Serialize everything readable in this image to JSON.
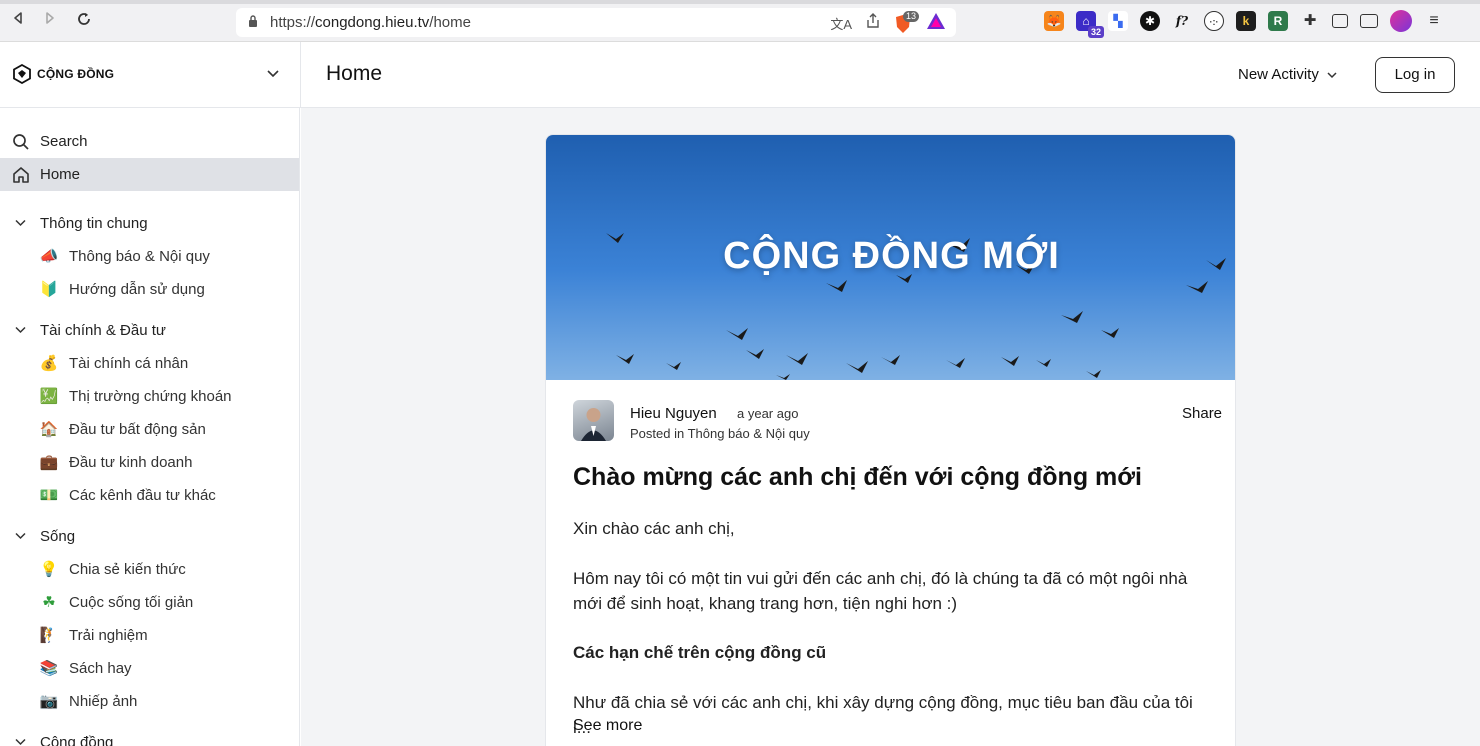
{
  "browser": {
    "url_scheme": "https://",
    "url_host": "congdong.hieu.tv",
    "url_path": "/home",
    "brave_badge": "13",
    "ext_badge": "32"
  },
  "header": {
    "logo_text": "CỘNG ĐỒNG",
    "page_title": "Home",
    "activity_label": "New Activity",
    "login_label": "Log in"
  },
  "sidebar": {
    "search_label": "Search",
    "home_label": "Home",
    "sections": [
      {
        "label": "Thông tin chung",
        "items": [
          {
            "emoji": "📣",
            "label": "Thông báo & Nội quy"
          },
          {
            "emoji": "🔰",
            "label": "Hướng dẫn sử dụng"
          }
        ]
      },
      {
        "label": "Tài chính & Đầu tư",
        "items": [
          {
            "emoji": "💰",
            "label": "Tài chính cá nhân"
          },
          {
            "emoji": "💹",
            "label": "Thị trường chứng khoán"
          },
          {
            "emoji": "🏠",
            "label": "Đầu tư bất động sản"
          },
          {
            "emoji": "💼",
            "label": "Đầu tư kinh doanh"
          },
          {
            "emoji": "💵",
            "label": "Các kênh đầu tư khác"
          }
        ]
      },
      {
        "label": "Sống",
        "items": [
          {
            "emoji": "💡",
            "label": "Chia sẻ kiến thức"
          },
          {
            "emoji": "☘",
            "label": "Cuộc sống tối giản"
          },
          {
            "emoji": "🧗",
            "label": "Trải nghiệm"
          },
          {
            "emoji": "📚",
            "label": "Sách hay"
          },
          {
            "emoji": "📷",
            "label": "Nhiếp ảnh"
          }
        ]
      },
      {
        "label": "Cộng đồng",
        "items": []
      }
    ]
  },
  "post": {
    "banner_text": "CỘNG ĐỒNG MỚI",
    "author": "Hieu Nguyen",
    "time": "a year ago",
    "posted_in": "Posted in Thông báo & Nội quy",
    "share_label": "Share",
    "title": "Chào mừng các anh chị đến với cộng đồng mới",
    "greeting": "Xin chào các anh chị,",
    "body1": "Hôm nay tôi có một tin vui gửi đến các anh chị, đó là chúng ta đã có một ngôi nhà mới để sinh hoạt, khang trang hơn, tiện nghi hơn :)",
    "heading": "Các hạn chế trên cộng đồng cũ",
    "body2": "Như đã chia sẻ với các anh chị, khi xây dựng cộng đồng, mục tiêu ban đầu của tôi l...",
    "see_more": "See more"
  },
  "colors": {
    "active_bg": "#dfe1e6",
    "main_bg": "#f3f4f6",
    "banner_sky": "#2f74c8"
  }
}
